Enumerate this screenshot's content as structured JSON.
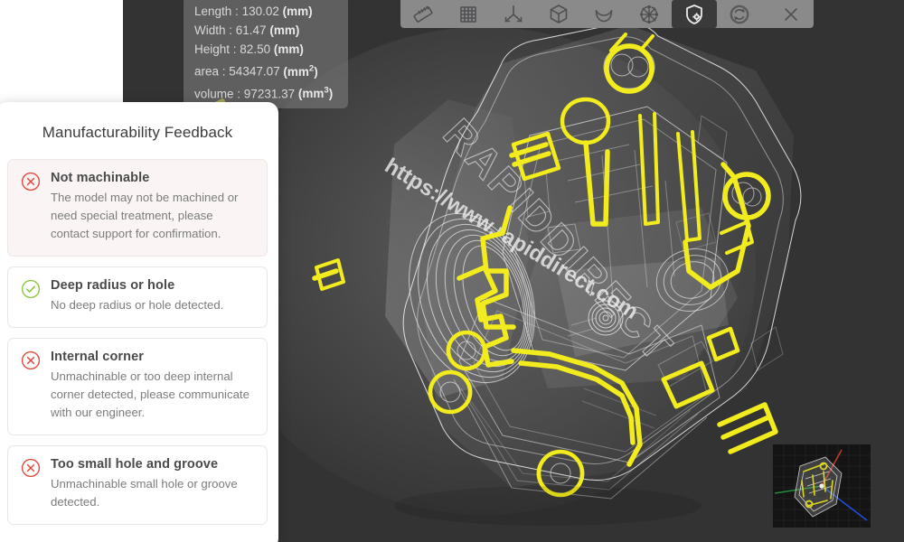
{
  "viewer": {
    "background_color": "#333333",
    "model_name": "RAPIDDIRECT",
    "watermark_text": "RAPIDDIRECT",
    "watermark_url": "https://www.rapiddirect.com",
    "highlight_color": "#f2ec1e",
    "wireframe_color": "#ffffff"
  },
  "dimensions": {
    "length_label": "Length",
    "length_value": "130.02",
    "length_unit": "mm",
    "width_label": "Width",
    "width_value": "61.47",
    "width_unit": "mm",
    "height_label": "Height",
    "height_value": "82.50",
    "height_unit": "mm",
    "area_label": "area",
    "area_value": "54347.07",
    "area_unit": "mm",
    "area_unit_exp": "2",
    "volume_label": "volume",
    "volume_value": "97231.37",
    "volume_unit": "mm",
    "volume_unit_exp": "3"
  },
  "toolbar": {
    "background_color": "#8a8a8a",
    "active_background": "#3a3a3a",
    "buttons": [
      {
        "name": "measure-ruler",
        "label": "Measure",
        "icon": "ruler-icon",
        "active": false
      },
      {
        "name": "grid",
        "label": "Grid",
        "icon": "grid-icon",
        "active": false
      },
      {
        "name": "axes",
        "label": "Axes",
        "icon": "axes-icon",
        "active": false
      },
      {
        "name": "bounding-box",
        "label": "Bounding Box",
        "icon": "cube-icon",
        "active": false
      },
      {
        "name": "section-curve",
        "label": "Section",
        "icon": "arc-icon",
        "active": false
      },
      {
        "name": "mesh",
        "label": "Mesh",
        "icon": "mesh-icon",
        "active": false
      },
      {
        "name": "manufacturability",
        "label": "Manufacturability",
        "icon": "shield-gear-icon",
        "active": true
      },
      {
        "name": "reset-view",
        "label": "Reset View",
        "icon": "refresh-icon",
        "active": false
      },
      {
        "name": "close",
        "label": "Close",
        "icon": "close-icon",
        "active": false
      }
    ]
  },
  "panel": {
    "title": "Manufacturability Feedback",
    "error_color": "#e04a3f",
    "ok_color": "#8dc63f",
    "cards": [
      {
        "status": "error",
        "icon": "circle-x-icon",
        "title": "Not machinable",
        "description": "The model may not be machined or need special treatment, please contact support for confirmation."
      },
      {
        "status": "ok",
        "icon": "circle-check-icon",
        "title": "Deep radius or hole",
        "description": "No deep radius or hole detected."
      },
      {
        "status": "error",
        "icon": "circle-x-icon",
        "title": "Internal corner",
        "description": "Unmachinable or too deep internal corner detected, please communicate with our engineer."
      },
      {
        "status": "error",
        "icon": "circle-x-icon",
        "title": "Too small hole and groove",
        "description": "Unmachinable small hole or groove detected."
      }
    ]
  },
  "minimap": {
    "name": "orientation-preview",
    "axis_x_color": "#c0392b",
    "axis_y_color": "#1f8a3a",
    "axis_z_color": "#1d4ed8",
    "background_color": "#141414"
  }
}
